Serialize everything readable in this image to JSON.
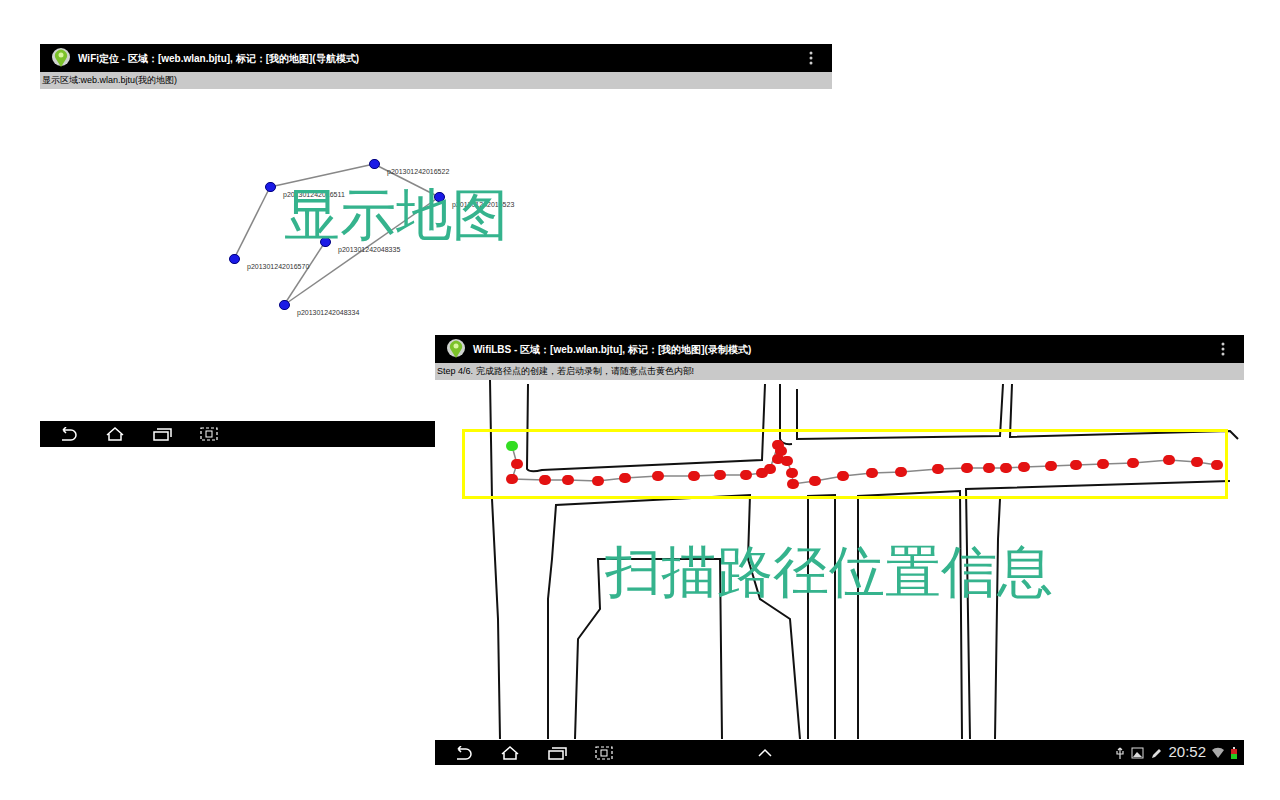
{
  "navigation_screen": {
    "title": "WiFi定位 - 区域：[web.wlan.bjtu], 标记：[我的地图](导航模式)",
    "subtitle": "显示区域:web.wlan.bjtu(我的地图)",
    "overlay": "显示地图",
    "nodes": [
      {
        "label": "p201301242016511"
      },
      {
        "label": "p201301242016522"
      },
      {
        "label": "p201301242016523"
      },
      {
        "label": "p201301242048335"
      },
      {
        "label": "p201301242016570"
      },
      {
        "label": "p201301242048334"
      }
    ],
    "edges": [
      [
        4,
        0
      ],
      [
        0,
        1
      ],
      [
        1,
        2
      ],
      [
        2,
        5
      ],
      [
        3,
        5
      ]
    ]
  },
  "recording_screen": {
    "title": "WifiLBS - 区域：[web.wlan.bjtu], 标记：[我的地图](录制模式)",
    "subtitle": "Step 4/6. 完成路径点的创建，若启动录制，请随意点击黄色内部!",
    "overlay": "扫描路径位置信息",
    "route": {
      "start_color": "#33dd22",
      "point_color": "#e31212"
    },
    "status_bar": {
      "time": "20:52"
    }
  }
}
